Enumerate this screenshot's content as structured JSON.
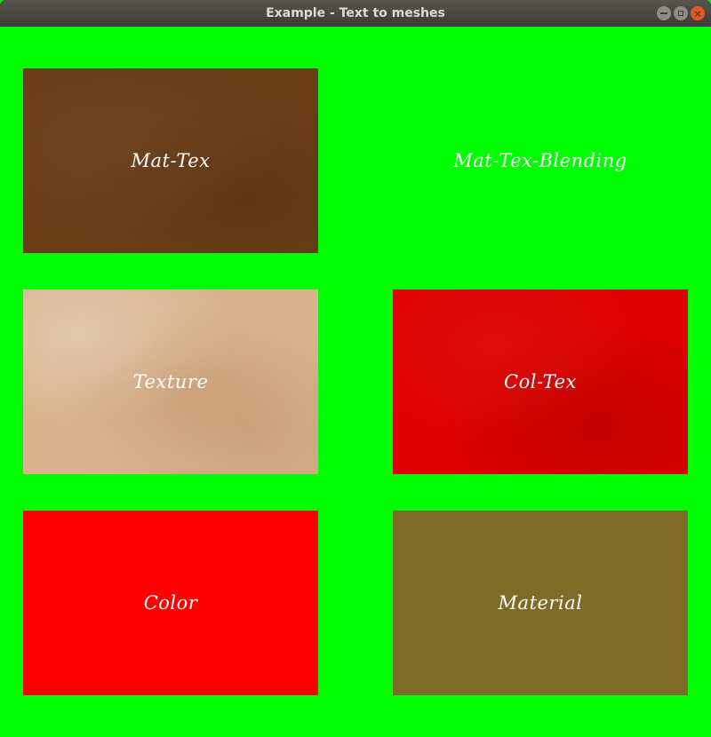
{
  "window": {
    "title": "Example - Text to meshes",
    "buttons": {
      "minimize_icon": "minimize-icon",
      "maximize_icon": "maximize-icon",
      "close_icon": "close-icon",
      "close_glyph": "×"
    }
  },
  "scene": {
    "background_color": "#00ff00",
    "tiles": [
      {
        "label": "Mat-Tex",
        "fill": "#6a3d17"
      },
      {
        "label": "Mat-Tex-Blending",
        "fill": "#00ff00"
      },
      {
        "label": "Texture",
        "fill": "#d9b48f"
      },
      {
        "label": "Col-Tex",
        "fill": "#de0000"
      },
      {
        "label": "Color",
        "fill": "#ff0000"
      },
      {
        "label": "Material",
        "fill": "#7f6b28"
      }
    ]
  }
}
